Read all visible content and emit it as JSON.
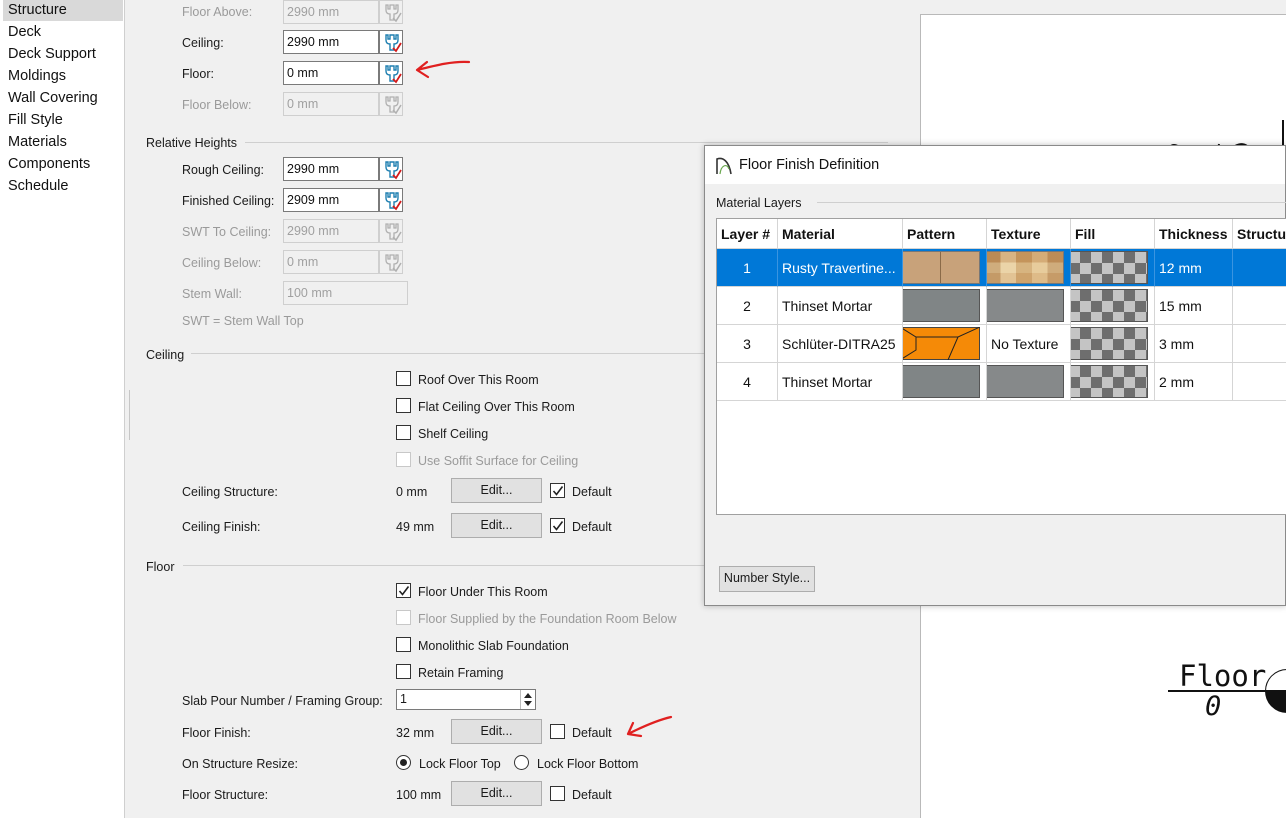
{
  "sidebar": {
    "items": [
      {
        "label": "Structure",
        "selected": true
      },
      {
        "label": "Deck"
      },
      {
        "label": "Deck Support"
      },
      {
        "label": "Moldings"
      },
      {
        "label": "Wall Covering"
      },
      {
        "label": "Fill Style"
      },
      {
        "label": "Materials"
      },
      {
        "label": "Components"
      },
      {
        "label": "Schedule"
      }
    ]
  },
  "absolute": {
    "floor_above_label": "Floor Above:",
    "floor_above_value": "2990 mm",
    "ceiling_label": "Ceiling:",
    "ceiling_value": "2990 mm",
    "floor_label": "Floor:",
    "floor_value": "0 mm",
    "floor_below_label": "Floor Below:",
    "floor_below_value": "0 mm"
  },
  "relative_heights": {
    "title": "Relative Heights",
    "rough_ceiling_label": "Rough Ceiling:",
    "rough_ceiling_value": "2990 mm",
    "finished_ceiling_label": "Finished Ceiling:",
    "finished_ceiling_value": "2909 mm",
    "swt_to_ceiling_label": "SWT To Ceiling:",
    "swt_to_ceiling_value": "2990 mm",
    "ceiling_below_label": "Ceiling Below:",
    "ceiling_below_value": "0 mm",
    "stem_wall_label": "Stem Wall:",
    "stem_wall_value": "100 mm",
    "swt_note": "SWT = Stem Wall Top"
  },
  "ceiling": {
    "title": "Ceiling",
    "roof_over": "Roof Over This Room",
    "flat_ceiling": "Flat Ceiling Over This Room",
    "shelf_ceiling": "Shelf Ceiling",
    "use_soffit": "Use Soffit Surface for Ceiling",
    "structure_label": "Ceiling Structure:",
    "structure_value": "0 mm",
    "finish_label": "Ceiling Finish:",
    "finish_value": "49 mm",
    "edit_label": "Edit...",
    "default_label": "Default"
  },
  "floor": {
    "title": "Floor",
    "floor_under": "Floor Under This Room",
    "floor_supplied": "Floor Supplied by the Foundation Room Below",
    "monolithic": "Monolithic Slab Foundation",
    "retain_framing": "Retain Framing",
    "slab_pour_label": "Slab Pour Number / Framing Group:",
    "slab_pour_value": "1",
    "finish_label": "Floor Finish:",
    "finish_value": "32 mm",
    "resize_label": "On Structure Resize:",
    "lock_top": "Lock Floor Top",
    "lock_bottom": "Lock Floor Bottom",
    "structure_label": "Floor Structure:",
    "structure_value": "100 mm",
    "edit_label": "Edit...",
    "default_label": "Default"
  },
  "dialog": {
    "title": "Floor Finish Definition",
    "section": "Material Layers",
    "columns": [
      "Layer #",
      "Material",
      "Pattern",
      "Texture",
      "Fill",
      "Thickness",
      "Structure"
    ],
    "rows": [
      {
        "layer": "1",
        "material": "Rusty Travertine...",
        "texture": "",
        "thickness": "12 mm"
      },
      {
        "layer": "2",
        "material": "Thinset Mortar",
        "texture": "",
        "thickness": "15 mm"
      },
      {
        "layer": "3",
        "material": "Schlüter-DITRA25",
        "texture": "No Texture",
        "thickness": "3 mm"
      },
      {
        "layer": "4",
        "material": "Thinset Mortar",
        "texture": "",
        "thickness": "2 mm"
      }
    ],
    "number_style_label": "Number Style..."
  },
  "preview": {
    "floor_text": "Floor",
    "floor_value": "0"
  },
  "colors": {
    "selection": "#0078d7",
    "annotation_arrow": "#e02020",
    "ditra_orange": "#f58a07",
    "mortar_gray": "#808586"
  }
}
